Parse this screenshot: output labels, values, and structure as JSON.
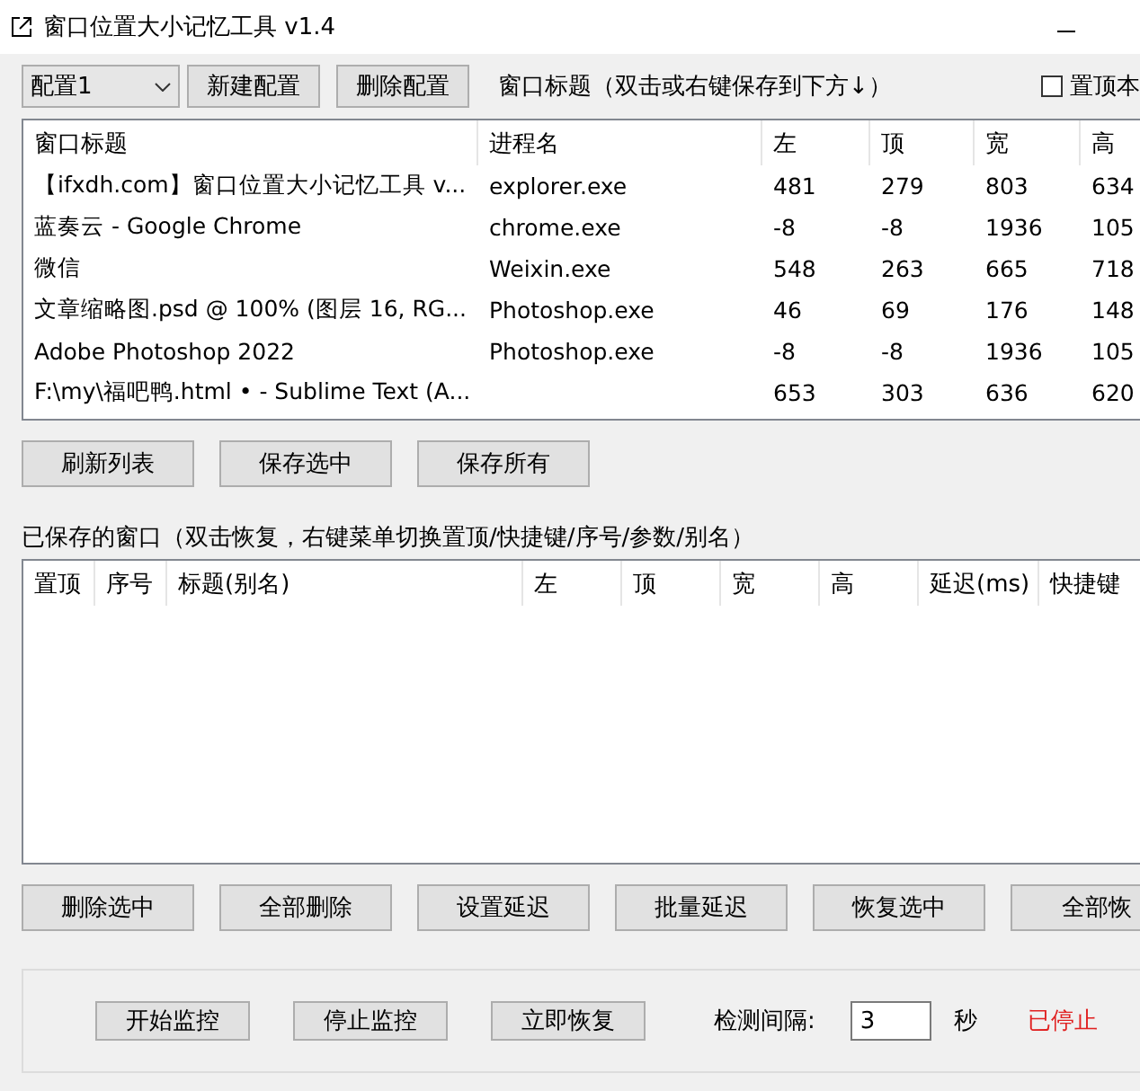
{
  "window": {
    "title": "窗口位置大小记忆工具 v1.4"
  },
  "toolbar": {
    "profile": "配置1",
    "buttons": [
      "新建配置",
      "删除配置"
    ],
    "hint": "窗口标题（双击或右键保存到下方↓）",
    "topmost": {
      "label": "置顶本",
      "checked": false
    }
  },
  "window_table": {
    "columns": [
      "窗口标题",
      "进程名",
      "左",
      "顶",
      "宽",
      "高"
    ],
    "rows": [
      {
        "cells": [
          "【ifxdh.com】窗口位置大小记忆工具 v...",
          "explorer.exe",
          "481",
          "279",
          "803",
          "634"
        ]
      },
      {
        "cells": [
          "蓝奏云 - Google Chrome",
          "chrome.exe",
          "-8",
          "-8",
          "1936",
          "105"
        ]
      },
      {
        "cells": [
          "微信",
          "Weixin.exe",
          "548",
          "263",
          "665",
          "718"
        ]
      },
      {
        "cells": [
          "文章缩略图.psd @ 100% (图层 16, RG...",
          "Photoshop.exe",
          "46",
          "69",
          "176",
          "148"
        ]
      },
      {
        "cells": [
          "Adobe Photoshop 2022",
          "Photoshop.exe",
          "-8",
          "-8",
          "1936",
          "105"
        ]
      },
      {
        "cells": [
          "F:\\my\\福吧鸭.html • - Sublime Text (A...",
          "",
          "653",
          "303",
          "636",
          "620"
        ]
      }
    ]
  },
  "list_buttons": [
    "刷新列表",
    "保存选中",
    "保存所有"
  ],
  "saved_label": "已保存的窗口（双击恢复，右键菜单切换置顶/快捷键/序号/参数/别名）",
  "saved_table": {
    "columns": [
      "置顶",
      "序号",
      "标题(别名)",
      "左",
      "顶",
      "宽",
      "高",
      "延迟(ms)",
      "快捷键"
    ]
  },
  "saved_buttons": [
    "删除选中",
    "全部删除",
    "设置延迟",
    "批量延迟",
    "恢复选中",
    "全部恢"
  ],
  "monitor": {
    "buttons": [
      "开始监控",
      "停止监控",
      "立即恢复"
    ],
    "interval_label": "检测间隔:",
    "interval": "3",
    "unit": "秒",
    "status": "已停止",
    "running": false
  }
}
